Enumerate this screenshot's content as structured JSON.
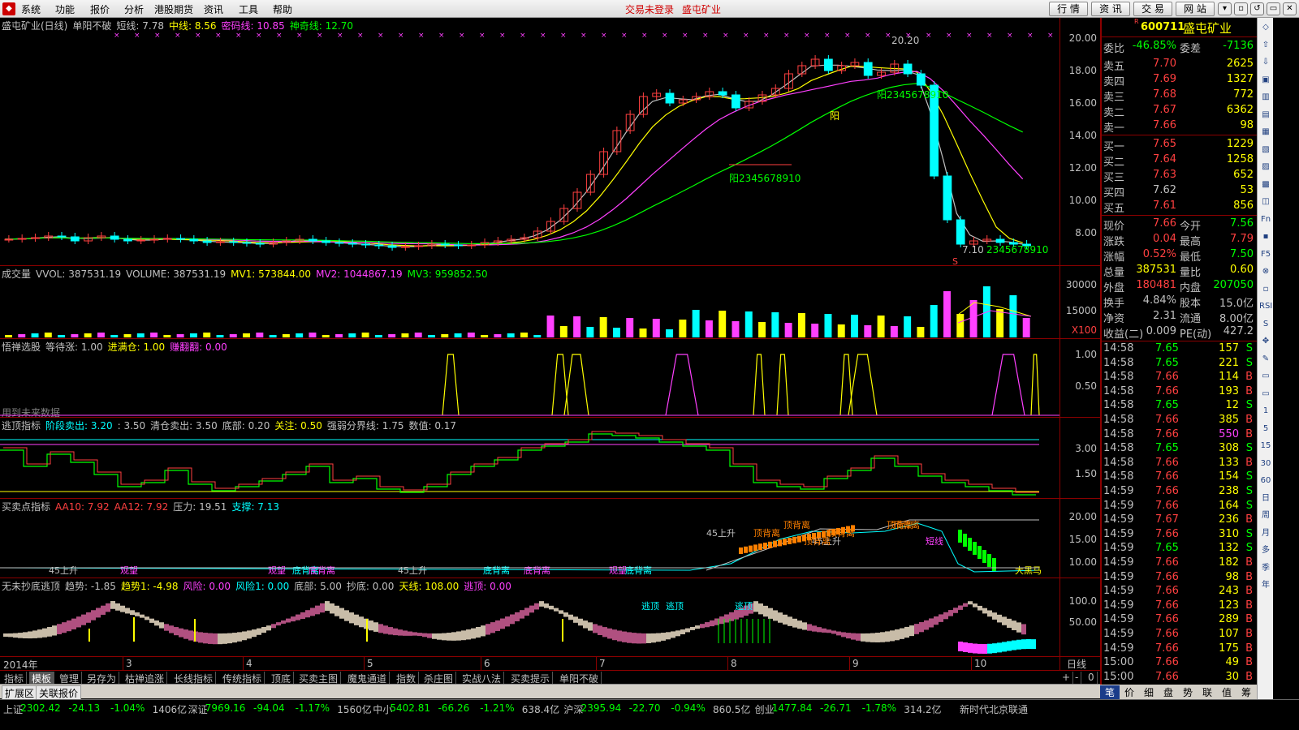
{
  "menu": {
    "items": [
      "系统",
      "功能",
      "报价",
      "分析",
      "港股期货",
      "资讯",
      "工具",
      "帮助"
    ],
    "status_links": [
      "交易未登录",
      "盛屯矿业"
    ],
    "toolbar_buttons": [
      "行 情",
      "资 讯",
      "交 易",
      "网 站"
    ],
    "window_controls": [
      "▾",
      "▫",
      "↺",
      "▭",
      "✕"
    ]
  },
  "main_chart": {
    "title": "盛屯矿业(日线)",
    "indicator": "单阳不破",
    "labels": [
      {
        "text": "短线: 7.78",
        "color": "#c0c0c0"
      },
      {
        "text": "中线: 8.56",
        "color": "#ffff00"
      },
      {
        "text": "密码线: 10.85",
        "color": "#ff40ff"
      },
      {
        "text": "神奇线: 12.70",
        "color": "#00ff00"
      }
    ],
    "y_ticks": [
      "20.00",
      "18.00",
      "16.00",
      "14.00",
      "12.00",
      "10.00",
      "8.00"
    ],
    "annotations": {
      "high": "20.20",
      "low": "7.10",
      "mid_label": "阳2345678910",
      "low_label": "2345678910",
      "top_label": "2345678910",
      "yang": "阳",
      "s_mark": "S"
    },
    "price_points": [
      8.1,
      8.15,
      8.2,
      8.3,
      8.25,
      8.0,
      8.2,
      8.3,
      8.1,
      8.0,
      8.05,
      8.1,
      8.15,
      8.1,
      8.0,
      7.9,
      7.95,
      7.9,
      7.85,
      7.8,
      7.9,
      8.0,
      8.1,
      8.0,
      7.9,
      7.85,
      7.8,
      7.75,
      7.7,
      7.6,
      7.65,
      7.7,
      7.8,
      7.75,
      7.7,
      7.75,
      7.9,
      8.0,
      8.1,
      8.2,
      8.6,
      9.2,
      10.0,
      11.0,
      12.1,
      13.5,
      14.8,
      15.8,
      16.9,
      17.1,
      16.5,
      16.7,
      16.9,
      17.2,
      17.0,
      16.2,
      16.6,
      17.0,
      17.4,
      18.3,
      18.8,
      19.2,
      18.5,
      18.8,
      19.0,
      18.2,
      18.4,
      18.9,
      18.3,
      17.6,
      12.0,
      9.3,
      7.8,
      8.0,
      8.1,
      7.9,
      7.8,
      7.7
    ]
  },
  "volume_panel": {
    "title": "成交量",
    "labels": [
      {
        "text": "VVOL: 387531.19",
        "color": "#c0c0c0"
      },
      {
        "text": "VOLUME: 387531.19",
        "color": "#c0c0c0"
      },
      {
        "text": "MV1: 573844.00",
        "color": "#ffff00"
      },
      {
        "text": "MV2: 1044867.19",
        "color": "#ff40ff"
      },
      {
        "text": "MV3: 959852.50",
        "color": "#00ff00"
      }
    ],
    "y_ticks": [
      "30000",
      "15000"
    ],
    "unit": "X100"
  },
  "panel3": {
    "title": "悟禅选股",
    "labels": [
      {
        "text": "等待涨: 1.00",
        "color": "#c0c0c0"
      },
      {
        "text": "进满仓: 1.00",
        "color": "#ffff00"
      },
      {
        "text": "赚翻翻: 0.00",
        "color": "#ff40ff"
      }
    ],
    "y_ticks": [
      "1.00",
      "0.50"
    ],
    "note": "用到未来数据"
  },
  "panel4": {
    "title": "逃顶指标",
    "labels": [
      {
        "text": "阶段卖出: 3.20",
        "color": "#00ffff"
      },
      {
        "text": ": 3.50",
        "color": "#c0c0c0"
      },
      {
        "text": "清仓卖出: 3.50",
        "color": "#c0c0c0"
      },
      {
        "text": "底部: 0.20",
        "color": "#c0c0c0"
      },
      {
        "text": "关注: 0.50",
        "color": "#ffff00"
      },
      {
        "text": "强弱分界线: 1.75",
        "color": "#c0c0c0"
      },
      {
        "text": "数值: 0.17",
        "color": "#c0c0c0"
      }
    ],
    "y_ticks": [
      "3.00",
      "1.50"
    ]
  },
  "panel5": {
    "title": "买卖点指标",
    "labels": [
      {
        "text": "AA10: 7.92",
        "color": "#ff4040"
      },
      {
        "text": "AA12: 7.92",
        "color": "#ff4040"
      },
      {
        "text": "压力: 19.51",
        "color": "#c0c0c0"
      },
      {
        "text": "支撑: 7.13",
        "color": "#00ffff"
      }
    ],
    "y_ticks": [
      "20.00",
      "15.00",
      "10.00"
    ],
    "markers": [
      "45上升",
      "观望",
      "观望",
      "底背离",
      "底背离",
      "45上升",
      "底背离",
      "底背离",
      "观望",
      "底背离",
      "顶背离",
      "45上升",
      "顶背离",
      "顶背离",
      "顶背离",
      "顶背离",
      "45上升",
      "短线",
      "顶背离",
      "大黑马"
    ]
  },
  "panel6": {
    "title": "无未抄底逃顶",
    "labels": [
      {
        "text": "趋势: -1.85",
        "color": "#c0c0c0"
      },
      {
        "text": "趋势1: -4.98",
        "color": "#ffff00"
      },
      {
        "text": "风险: 0.00",
        "color": "#ff40ff"
      },
      {
        "text": "风险1: 0.00",
        "color": "#00ffff"
      },
      {
        "text": "底部: 5.00",
        "color": "#c0c0c0"
      },
      {
        "text": "抄底: 0.00",
        "color": "#c0c0c0"
      },
      {
        "text": "天线: 108.00",
        "color": "#ffff00"
      },
      {
        "text": "逃顶: 0.00",
        "color": "#ff40ff"
      }
    ],
    "y_ticks": [
      "100.0",
      "50.00"
    ],
    "markers": [
      "逃顶",
      "逃顶",
      "逃顶"
    ]
  },
  "x_axis": {
    "labels": [
      "2014年",
      "3",
      "4",
      "5",
      "6",
      "7",
      "8",
      "9",
      "10"
    ],
    "mode": "日线"
  },
  "tabs": [
    "指标",
    "模板",
    "管理",
    "另存为",
    "枯禅追涨",
    "长线指标",
    "传统指标",
    "顶底",
    "买卖主图",
    "魔鬼通道",
    "指数",
    "杀庄图",
    "实战八法",
    "买卖提示",
    "单阳不破"
  ],
  "active_tab": 1,
  "tabs2": [
    "扩展区",
    "关联报价"
  ],
  "zoom_controls": [
    "+",
    "-",
    "0"
  ],
  "quote": {
    "code": "600711",
    "name": "盛屯矿业",
    "r_mark": "R",
    "weibi": {
      "label": "委比",
      "value": "-46.85%",
      "label2": "委差",
      "value2": "-7136"
    },
    "asks": [
      {
        "label": "卖五",
        "price": "7.70",
        "vol": "2625"
      },
      {
        "label": "卖四",
        "price": "7.69",
        "vol": "1327"
      },
      {
        "label": "卖三",
        "price": "7.68",
        "vol": "772"
      },
      {
        "label": "卖二",
        "price": "7.67",
        "vol": "6362"
      },
      {
        "label": "卖一",
        "price": "7.66",
        "vol": "98"
      }
    ],
    "bids": [
      {
        "label": "买一",
        "price": "7.65",
        "vol": "1229"
      },
      {
        "label": "买二",
        "price": "7.64",
        "vol": "1258"
      },
      {
        "label": "买三",
        "price": "7.63",
        "vol": "652"
      },
      {
        "label": "买四",
        "price": "7.62",
        "vol": "53"
      },
      {
        "label": "买五",
        "price": "7.61",
        "vol": "856"
      }
    ],
    "stats": [
      {
        "l1": "现价",
        "v1": "7.66",
        "c1": "#ff4040",
        "l2": "今开",
        "v2": "7.56",
        "c2": "#00ff00"
      },
      {
        "l1": "涨跌",
        "v1": "0.04",
        "c1": "#ff4040",
        "l2": "最高",
        "v2": "7.79",
        "c2": "#ff4040"
      },
      {
        "l1": "涨幅",
        "v1": "0.52%",
        "c1": "#ff4040",
        "l2": "最低",
        "v2": "7.50",
        "c2": "#00ff00"
      },
      {
        "l1": "总量",
        "v1": "387531",
        "c1": "#ffff00",
        "l2": "量比",
        "v2": "0.60",
        "c2": "#ffff00"
      },
      {
        "l1": "外盘",
        "v1": "180481",
        "c1": "#ff4040",
        "l2": "内盘",
        "v2": "207050",
        "c2": "#00ff00"
      },
      {
        "l1": "换手",
        "v1": "4.84%",
        "c1": "#c0c0c0",
        "l2": "股本",
        "v2": "15.0亿",
        "c2": "#c0c0c0"
      },
      {
        "l1": "净资",
        "v1": "2.31",
        "c1": "#c0c0c0",
        "l2": "流通",
        "v2": "8.00亿",
        "c2": "#c0c0c0"
      },
      {
        "l1": "收益(二)",
        "v1": "0.009",
        "c1": "#c0c0c0",
        "l2": "PE(动)",
        "v2": "427.2",
        "c2": "#c0c0c0"
      }
    ],
    "ticks": [
      {
        "t": "14:58",
        "p": "7.65",
        "v": "157",
        "s": "S"
      },
      {
        "t": "14:58",
        "p": "7.65",
        "v": "221",
        "s": "S"
      },
      {
        "t": "14:58",
        "p": "7.66",
        "v": "114",
        "s": "B"
      },
      {
        "t": "14:58",
        "p": "7.66",
        "v": "193",
        "s": "B"
      },
      {
        "t": "14:58",
        "p": "7.65",
        "v": "12",
        "s": "S"
      },
      {
        "t": "14:58",
        "p": "7.66",
        "v": "385",
        "s": "B"
      },
      {
        "t": "14:58",
        "p": "7.66",
        "v": "550",
        "s": "B"
      },
      {
        "t": "14:58",
        "p": "7.65",
        "v": "308",
        "s": "S"
      },
      {
        "t": "14:58",
        "p": "7.66",
        "v": "133",
        "s": "B"
      },
      {
        "t": "14:58",
        "p": "7.66",
        "v": "154",
        "s": "S"
      },
      {
        "t": "14:59",
        "p": "7.66",
        "v": "238",
        "s": "S"
      },
      {
        "t": "14:59",
        "p": "7.66",
        "v": "164",
        "s": "S"
      },
      {
        "t": "14:59",
        "p": "7.67",
        "v": "236",
        "s": "B"
      },
      {
        "t": "14:59",
        "p": "7.66",
        "v": "310",
        "s": "S"
      },
      {
        "t": "14:59",
        "p": "7.65",
        "v": "132",
        "s": "S"
      },
      {
        "t": "14:59",
        "p": "7.66",
        "v": "182",
        "s": "B"
      },
      {
        "t": "14:59",
        "p": "7.66",
        "v": "98",
        "s": "B"
      },
      {
        "t": "14:59",
        "p": "7.66",
        "v": "243",
        "s": "B"
      },
      {
        "t": "14:59",
        "p": "7.66",
        "v": "123",
        "s": "B"
      },
      {
        "t": "14:59",
        "p": "7.66",
        "v": "289",
        "s": "B"
      },
      {
        "t": "14:59",
        "p": "7.66",
        "v": "107",
        "s": "B"
      },
      {
        "t": "14:59",
        "p": "7.66",
        "v": "175",
        "s": "B"
      },
      {
        "t": "15:00",
        "p": "7.66",
        "v": "49",
        "s": "B"
      },
      {
        "t": "15:00",
        "p": "7.66",
        "v": "30",
        "s": "B"
      }
    ],
    "subtabs": [
      "笔",
      "价",
      "细",
      "盘",
      "势",
      "联",
      "值",
      "筹"
    ]
  },
  "toolstrip": [
    "◇",
    "⇧",
    "⇩",
    "▣",
    "▥",
    "▤",
    "▦",
    "▧",
    "▨",
    "▩",
    "◫",
    "Fn",
    "▪",
    "F5",
    "⊗",
    "▫",
    "RSI",
    "S",
    "✥",
    "✎",
    "▭",
    "▭",
    "1",
    "5",
    "15",
    "30",
    "60",
    "日",
    "周",
    "月",
    "多",
    "季",
    "年"
  ],
  "statusbar": [
    {
      "text": "上证",
      "color": "#c0c0c0"
    },
    {
      "text": "2302.42",
      "color": "#00ff00"
    },
    {
      "text": "-24.13",
      "color": "#00ff00"
    },
    {
      "text": "-1.04%",
      "color": "#00ff00"
    },
    {
      "text": "1406亿",
      "color": "#c0c0c0"
    },
    {
      "text": "深证",
      "color": "#c0c0c0"
    },
    {
      "text": "7969.16",
      "color": "#00ff00"
    },
    {
      "text": "-94.04",
      "color": "#00ff00"
    },
    {
      "text": "-1.17%",
      "color": "#00ff00"
    },
    {
      "text": "1560亿",
      "color": "#c0c0c0"
    },
    {
      "text": "中小",
      "color": "#c0c0c0"
    },
    {
      "text": "5402.81",
      "color": "#00ff00"
    },
    {
      "text": "-66.26",
      "color": "#00ff00"
    },
    {
      "text": "-1.21%",
      "color": "#00ff00"
    },
    {
      "text": "638.4亿",
      "color": "#c0c0c0"
    },
    {
      "text": "沪深",
      "color": "#c0c0c0"
    },
    {
      "text": "2395.94",
      "color": "#00ff00"
    },
    {
      "text": "-22.70",
      "color": "#00ff00"
    },
    {
      "text": "-0.94%",
      "color": "#00ff00"
    },
    {
      "text": "860.5亿",
      "color": "#c0c0c0"
    },
    {
      "text": "创业",
      "color": "#c0c0c0"
    },
    {
      "text": "1477.84",
      "color": "#00ff00"
    },
    {
      "text": "-26.71",
      "color": "#00ff00"
    },
    {
      "text": "-1.78%",
      "color": "#00ff00"
    },
    {
      "text": "314.2亿",
      "color": "#c0c0c0"
    },
    {
      "text": "新时代北京联通",
      "color": "#c0c0c0"
    }
  ]
}
